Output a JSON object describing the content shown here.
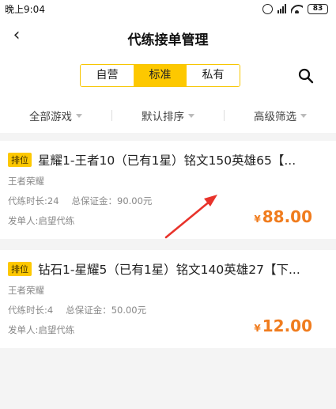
{
  "status_bar": {
    "time": "晚上9:04",
    "battery": "83"
  },
  "header": {
    "title": "代练接单管理",
    "tabs": [
      "自营",
      "标准",
      "私有"
    ],
    "active_tab": "标准"
  },
  "filters": [
    "全部游戏",
    "默认排序",
    "高级筛选"
  ],
  "orders": [
    {
      "tag": "排位",
      "title": "星耀1-王者10（已有1星）铭文150英雄65【...",
      "game": "王者荣耀",
      "duration": "代练时长:24",
      "deposit": "总保证金：90.00元",
      "poster": "发单人:启望代练",
      "currency": "¥",
      "price": "88.00"
    },
    {
      "tag": "排位",
      "title": "钻石1-星耀5（已有1星）铭文140英雄27【下...",
      "game": "王者荣耀",
      "duration": "代练时长:4",
      "deposit": "总保证金：50.00元",
      "poster": "发单人:启望代练",
      "currency": "¥",
      "price": "12.00"
    }
  ],
  "colors": {
    "accent": "#fdc800",
    "price": "#f07c1e",
    "annotation_arrow": "#e8332b"
  }
}
